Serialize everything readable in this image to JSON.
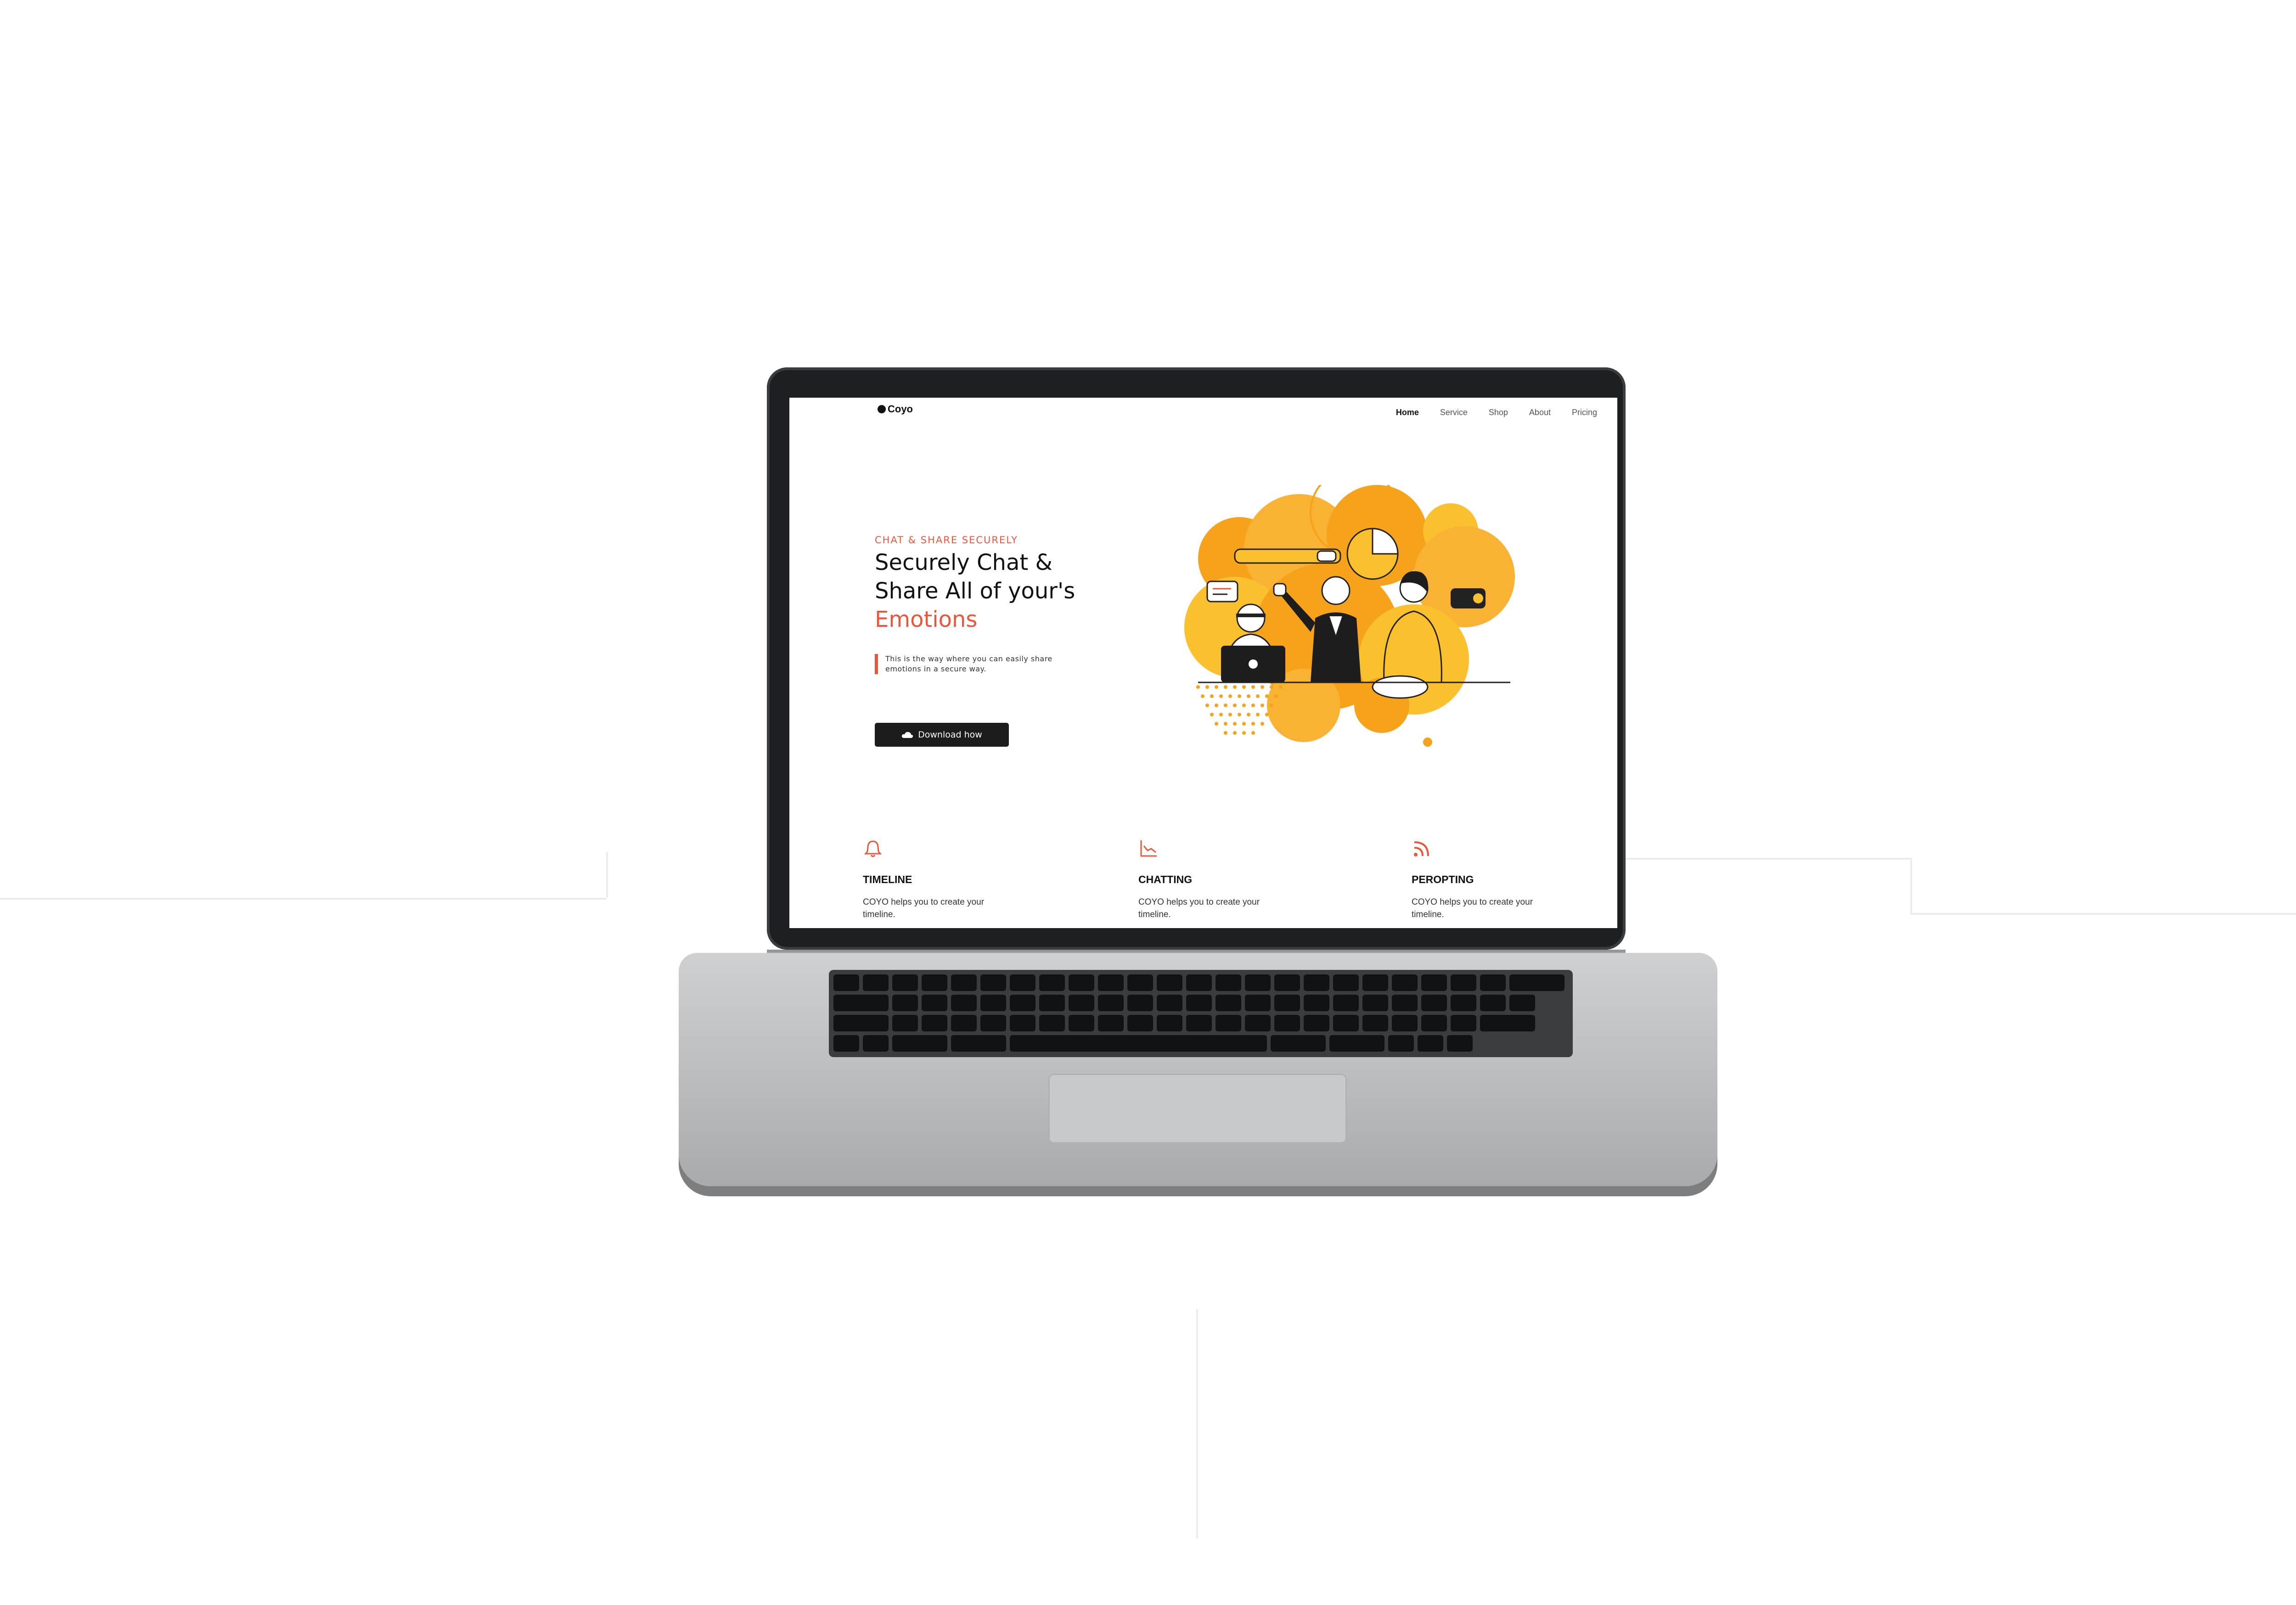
{
  "site": {
    "logo_text": "Coyo",
    "nav": [
      {
        "label": "Home",
        "active": true
      },
      {
        "label": "Service",
        "active": false
      },
      {
        "label": "Shop",
        "active": false
      },
      {
        "label": "About",
        "active": false
      },
      {
        "label": "Pricing",
        "active": false
      }
    ],
    "hero": {
      "eyebrow": "CHAT & SHARE SECURELY",
      "headline_line1": "Securely Chat &",
      "headline_line2": "Share All of your's",
      "headline_accent": "Emotions",
      "description": "This is the way where you can easily share emotions in a secure way.",
      "cta_label": "Download how",
      "cta_icon": "cloud-icon"
    },
    "features": [
      {
        "icon": "bell-icon",
        "title": "TIMELINE",
        "description": "COYO helps you to create your timeline."
      },
      {
        "icon": "chart-icon",
        "title": "CHATTING",
        "description": "COYO helps you to create your timeline."
      },
      {
        "icon": "rss-icon",
        "title": "PEROPTING",
        "description": "COYO helps you to create your timeline."
      }
    ]
  },
  "colors": {
    "accent": "#e8573c",
    "illustration_orange": "#f7a21b",
    "illustration_yellow": "#fbc02d",
    "button_dark": "#1c1c1c"
  }
}
